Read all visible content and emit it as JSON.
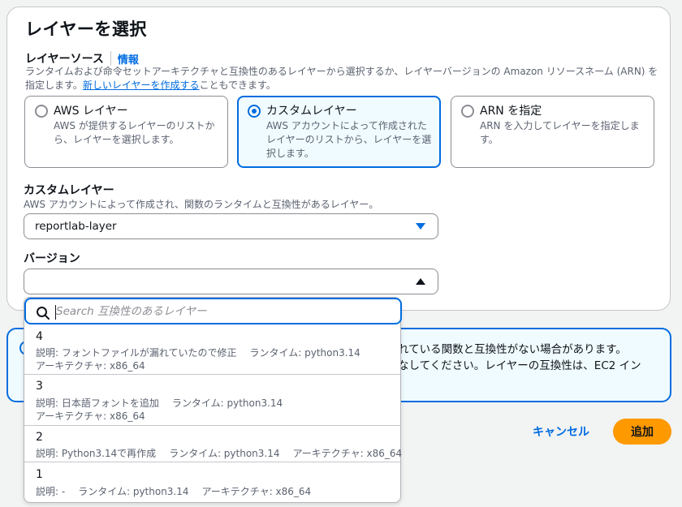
{
  "page": {
    "title": "レイヤーを選択"
  },
  "layer_source": {
    "label": "レイヤーソース",
    "info_link": "情報",
    "description_prefix": "ランタイムおよび命令セットアーキテクチャと互換性のあるレイヤーから選択するか、レイヤーバージョンの Amazon リソースネーム (ARN) を指定します。",
    "create_link": "新しいレイヤーを作成する",
    "description_suffix": "こともできます。",
    "options": [
      {
        "title": "AWS レイヤー",
        "description": "AWS が提供するレイヤーのリストから、レイヤーを選択します。",
        "selected": false
      },
      {
        "title": "カスタムレイヤー",
        "description": "AWS アカウントによって作成されたレイヤーのリストから、レイヤーを選択します。",
        "selected": true
      },
      {
        "title": "ARN を指定",
        "description": "ARN を入力してレイヤーを指定します。",
        "selected": false
      }
    ]
  },
  "custom_layer": {
    "label": "カスタムレイヤー",
    "description": "AWS アカウントによって作成され、関数のランタイムと互換性があるレイヤー。",
    "selected_value": "reportlab-layer"
  },
  "version": {
    "label": "バージョン",
    "selected_value": ""
  },
  "dropdown": {
    "search_placeholder": "Search 互換性のあるレイヤー",
    "options": [
      {
        "name": "4",
        "description": "説明: フォントファイルが漏れていたので修正",
        "runtime": "ランタイム: python3.14",
        "architecture": "アーキテクチャ: x86_64"
      },
      {
        "name": "3",
        "description": "説明: 日本語フォントを追加",
        "runtime": "ランタイム: python3.14",
        "architecture": "アーキテクチャ: x86_64"
      },
      {
        "name": "2",
        "description": "説明: Python3.14で再作成",
        "runtime": "ランタイム: python3.14",
        "architecture": "アーキテクチャ: x86_64"
      },
      {
        "name": "1",
        "description": "説明: -",
        "runtime": "ランタイム: python3.14",
        "architecture": "アーキテクチャ: x86_64"
      }
    ]
  },
  "alert": {
    "text_line1": "れている関数と互換性がない場合があります。",
    "text_line2": "なしてください。レイヤーの互換性は、EC2 イン"
  },
  "actions": {
    "cancel": "キャンセル",
    "add": "追加"
  },
  "colors": {
    "accent": "#006ce0",
    "primary_button": "#ff9900",
    "selected_tile_bg": "#f0fbff"
  }
}
